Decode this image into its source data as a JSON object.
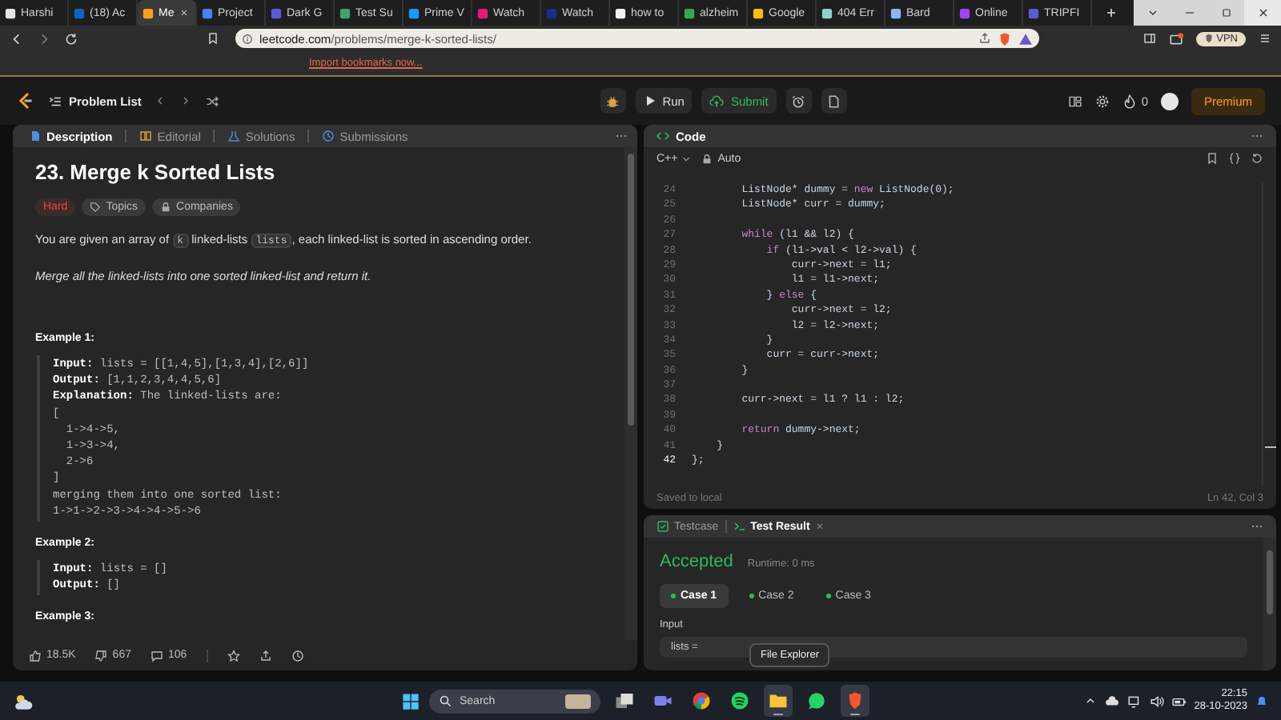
{
  "browser": {
    "tabs": [
      {
        "title": "Harshi",
        "selected": false,
        "color": "#e6e6e6"
      },
      {
        "title": "(18) Ac",
        "selected": false,
        "color": "#0a66c2"
      },
      {
        "title": "Me",
        "selected": true,
        "color": "#ffa116"
      },
      {
        "title": "Project",
        "selected": false,
        "color": "#4285f4"
      },
      {
        "title": "Dark G",
        "selected": false,
        "color": "#5b5bd6"
      },
      {
        "title": "Test Su",
        "selected": false,
        "color": "#3ca36b"
      },
      {
        "title": "Prime V",
        "selected": false,
        "color": "#1a98ff"
      },
      {
        "title": "Watch",
        "selected": false,
        "color": "#e6197a"
      },
      {
        "title": "Watch",
        "selected": false,
        "color": "#1b2c8f"
      },
      {
        "title": "how to",
        "selected": false,
        "color": "#f2f2f2"
      },
      {
        "title": "alzheim",
        "selected": false,
        "color": "#34a853"
      },
      {
        "title": "Google",
        "selected": false,
        "color": "#fbbc04"
      },
      {
        "title": "404 Err",
        "selected": false,
        "color": "#8fd3c6"
      },
      {
        "title": "Bard",
        "selected": false,
        "color": "#8ab4f8"
      },
      {
        "title": "Online",
        "selected": false,
        "color": "#a142f4"
      },
      {
        "title": "TRIPFI",
        "selected": false,
        "color": "#5b5bd6"
      }
    ],
    "address": {
      "domain": "leetcode.com",
      "path": "/problems/merge-k-sorted-lists/"
    },
    "vpn": "VPN",
    "bookmarks_bar": {
      "link": "Import bookmarks now..."
    }
  },
  "header": {
    "problem_list": "Problem List",
    "run": "Run",
    "submit": "Submit",
    "streak": "0",
    "premium": "Premium"
  },
  "description_panel": {
    "tabs": [
      {
        "label": "Description",
        "selected": true
      },
      {
        "label": "Editorial",
        "selected": false
      },
      {
        "label": "Solutions",
        "selected": false
      },
      {
        "label": "Submissions",
        "selected": false
      }
    ],
    "title": "23. Merge k Sorted Lists",
    "tags": [
      {
        "label": "Hard",
        "kind": "difficulty"
      },
      {
        "label": "Topics",
        "kind": "topics"
      },
      {
        "label": "Companies",
        "kind": "companies"
      }
    ],
    "statement": [
      {
        "kind": "text",
        "text": "You are given an array of "
      },
      {
        "kind": "code",
        "text": "k"
      },
      {
        "kind": "text",
        "text": " linked-lists "
      },
      {
        "kind": "code",
        "text": "lists"
      },
      {
        "kind": "text",
        "text": ", each linked-list is sorted in ascending order."
      }
    ],
    "task": "Merge all the linked-lists into one sorted linked-list and return it.",
    "examples": [
      {
        "heading": "Example 1:",
        "lines": [
          "**Input:** lists = [[1,4,5],[1,3,4],[2,6]]",
          "**Output:** [1,1,2,3,4,4,5,6]",
          "**Explanation:** The linked-lists are:",
          "[",
          "  1->4->5,",
          "  1->3->4,",
          "  2->6",
          "]",
          "merging them into one sorted list:",
          "1->1->2->3->4->4->5->6"
        ]
      },
      {
        "heading": "Example 2:",
        "lines": [
          "**Input:** lists = []",
          "**Output:** []"
        ]
      },
      {
        "heading": "Example 3:"
      }
    ],
    "footer": {
      "likes": "18.5K",
      "dislikes": "667",
      "comments": "106"
    }
  },
  "code_panel": {
    "title": "Code",
    "language": "C++",
    "mode": "Auto",
    "lines": [
      {
        "number": "24",
        "current": false,
        "tokens": [
          {
            "kind": "plain",
            "text": "        ListNode* dummy = "
          },
          {
            "kind": "keyword",
            "text": "new"
          },
          {
            "kind": "plain",
            "text": " ListNode(0);"
          }
        ]
      },
      {
        "number": "25",
        "current": false,
        "tokens": [
          {
            "kind": "plain",
            "text": "        ListNode* curr = dummy;"
          }
        ]
      },
      {
        "number": "26",
        "current": false
      },
      {
        "number": "27",
        "current": false,
        "tokens": [
          {
            "kind": "keyword",
            "text": "        while"
          },
          {
            "kind": "plain",
            "text": " (l1 && l2) {"
          }
        ]
      },
      {
        "number": "28",
        "current": false,
        "tokens": [
          {
            "kind": "keyword",
            "text": "            if"
          },
          {
            "kind": "plain",
            "text": " (l1->val < l2->val) {"
          }
        ]
      },
      {
        "number": "29",
        "current": false,
        "tokens": [
          {
            "kind": "plain",
            "text": "                curr->next = l1;"
          }
        ]
      },
      {
        "number": "30",
        "current": false,
        "tokens": [
          {
            "kind": "plain",
            "text": "                l1 = l1->next;"
          }
        ]
      },
      {
        "number": "31",
        "current": false,
        "tokens": [
          {
            "kind": "plain",
            "text": "            } "
          },
          {
            "kind": "keyword",
            "text": "else"
          },
          {
            "kind": "plain",
            "text": " {"
          }
        ]
      },
      {
        "number": "32",
        "current": false,
        "tokens": [
          {
            "kind": "plain",
            "text": "                curr->next = l2;"
          }
        ]
      },
      {
        "number": "33",
        "current": false,
        "tokens": [
          {
            "kind": "plain",
            "text": "                l2 = l2->next;"
          }
        ]
      },
      {
        "number": "34",
        "current": false,
        "tokens": [
          {
            "kind": "plain",
            "text": "            }"
          }
        ]
      },
      {
        "number": "35",
        "current": false,
        "tokens": [
          {
            "kind": "plain",
            "text": "            curr = curr->next;"
          }
        ]
      },
      {
        "number": "36",
        "current": false,
        "tokens": [
          {
            "kind": "plain",
            "text": "        }"
          }
        ]
      },
      {
        "number": "37",
        "current": false
      },
      {
        "number": "38",
        "current": false,
        "tokens": [
          {
            "kind": "plain",
            "text": "        curr->next = l1 ? l1 : l2;"
          }
        ]
      },
      {
        "number": "39",
        "current": false
      },
      {
        "number": "40",
        "current": false,
        "tokens": [
          {
            "kind": "keyword",
            "text": "        return"
          },
          {
            "kind": "plain",
            "text": " dummy->next;"
          }
        ]
      },
      {
        "number": "41",
        "current": false,
        "tokens": [
          {
            "kind": "plain",
            "text": "    }"
          }
        ]
      },
      {
        "number": "42",
        "current": true,
        "tokens": [
          {
            "kind": "plain",
            "text": "};"
          }
        ]
      }
    ],
    "status": "Saved to local",
    "cursor": "Ln 42, Col 3"
  },
  "result_panel": {
    "tabs": [
      {
        "label": "Testcase",
        "selected": false
      },
      {
        "label": "Test Result",
        "selected": true
      }
    ],
    "verdict": "Accepted",
    "runtime": "Runtime: 0 ms",
    "cases": [
      {
        "label": "Case 1",
        "selected": true,
        "passed": true
      },
      {
        "label": "Case 2",
        "selected": false,
        "passed": true
      },
      {
        "label": "Case 3",
        "selected": false,
        "passed": true
      }
    ],
    "input_label": "Input",
    "input_value": "lists ="
  },
  "tooltip": "File Explorer",
  "taskbar": {
    "search": {
      "placeholder": "Search"
    },
    "apps": [
      {
        "kind": "task-view",
        "running": false
      },
      {
        "kind": "meet",
        "running": false
      },
      {
        "kind": "chrome",
        "running": false
      },
      {
        "kind": "spotify",
        "running": false
      },
      {
        "kind": "files",
        "running": true
      },
      {
        "kind": "whatsapp",
        "running": false
      },
      {
        "kind": "brave",
        "running": true
      }
    ],
    "time": "22:15",
    "date": "28-10-2023"
  }
}
